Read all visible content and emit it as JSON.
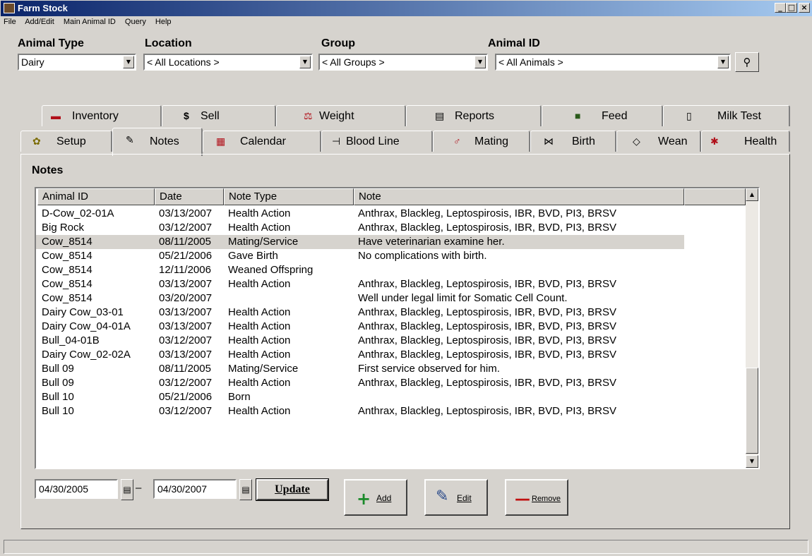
{
  "window": {
    "title": "Farm Stock"
  },
  "menu": [
    "File",
    "Add/Edit",
    "Main Animal ID",
    "Query",
    "Help"
  ],
  "filters": {
    "animal_type": {
      "label": "Animal Type",
      "value": "Dairy"
    },
    "location": {
      "label": "Location",
      "value": "< All Locations >"
    },
    "group": {
      "label": "Group",
      "value": "< All Groups >"
    },
    "animal_id": {
      "label": "Animal ID",
      "value": "< All Animals >"
    }
  },
  "tabs_row1": [
    {
      "label": "Inventory",
      "icon": "▬"
    },
    {
      "label": "Sell",
      "icon": "$"
    },
    {
      "label": "Weight",
      "icon": "⚖"
    },
    {
      "label": "Reports",
      "icon": "▤"
    },
    {
      "label": "Feed",
      "icon": "■"
    },
    {
      "label": "Milk Test",
      "icon": "▯"
    }
  ],
  "tabs_row2": [
    {
      "label": "Setup",
      "icon": "✿"
    },
    {
      "label": "Notes",
      "icon": "✎"
    },
    {
      "label": "Calendar",
      "icon": "▦"
    },
    {
      "label": "Blood Line",
      "icon": "⊣"
    },
    {
      "label": "Mating",
      "icon": "♂"
    },
    {
      "label": "Birth",
      "icon": "⋈"
    },
    {
      "label": "Wean",
      "icon": "◇"
    },
    {
      "label": "Health",
      "icon": "✱"
    }
  ],
  "notes": {
    "title": "Notes",
    "columns": [
      "Animal ID",
      "Date",
      "Note Type",
      "Note"
    ],
    "rows": [
      [
        "D-Cow_02-01A",
        "03/13/2007",
        "Health Action",
        "Anthrax, Blackleg, Leptospirosis, IBR, BVD, PI3, BRSV"
      ],
      [
        "Big Rock",
        "03/12/2007",
        "Health Action",
        "Anthrax, Blackleg, Leptospirosis, IBR, BVD, PI3, BRSV"
      ],
      [
        "Cow_8514",
        "08/11/2005",
        "Mating/Service",
        "Have veterinarian examine her."
      ],
      [
        "Cow_8514",
        "05/21/2006",
        "Gave Birth",
        "No complications with birth."
      ],
      [
        "Cow_8514",
        "12/11/2006",
        "Weaned Offspring",
        ""
      ],
      [
        "Cow_8514",
        "03/13/2007",
        "Health Action",
        "Anthrax, Blackleg, Leptospirosis, IBR, BVD, PI3, BRSV"
      ],
      [
        "Cow_8514",
        "03/20/2007",
        "",
        "Well under legal limit for Somatic Cell Count."
      ],
      [
        "Dairy Cow_03-01",
        "03/13/2007",
        "Health Action",
        "Anthrax, Blackleg, Leptospirosis, IBR, BVD, PI3, BRSV"
      ],
      [
        "Dairy Cow_04-01A",
        "03/13/2007",
        "Health Action",
        "Anthrax, Blackleg, Leptospirosis, IBR, BVD, PI3, BRSV"
      ],
      [
        "Bull_04-01B",
        "03/12/2007",
        "Health Action",
        "Anthrax, Blackleg, Leptospirosis, IBR, BVD, PI3, BRSV"
      ],
      [
        "Dairy Cow_02-02A",
        "03/13/2007",
        "Health Action",
        "Anthrax, Blackleg, Leptospirosis, IBR, BVD, PI3, BRSV"
      ],
      [
        "Bull 09",
        "08/11/2005",
        "Mating/Service",
        "First service observed for him."
      ],
      [
        "Bull 09",
        "03/12/2007",
        "Health Action",
        "Anthrax, Blackleg, Leptospirosis, IBR, BVD, PI3, BRSV"
      ],
      [
        "Bull 10",
        "05/21/2006",
        "Born",
        ""
      ],
      [
        "Bull 10",
        "03/12/2007",
        "Health Action",
        "Anthrax, Blackleg, Leptospirosis, IBR, BVD, PI3, BRSV"
      ]
    ]
  },
  "date_range": {
    "from": "04/30/2005",
    "separator": "–",
    "to": "04/30/2007"
  },
  "buttons": {
    "update": "Update",
    "add": "Add",
    "edit": "Edit",
    "remove": "Remove"
  }
}
